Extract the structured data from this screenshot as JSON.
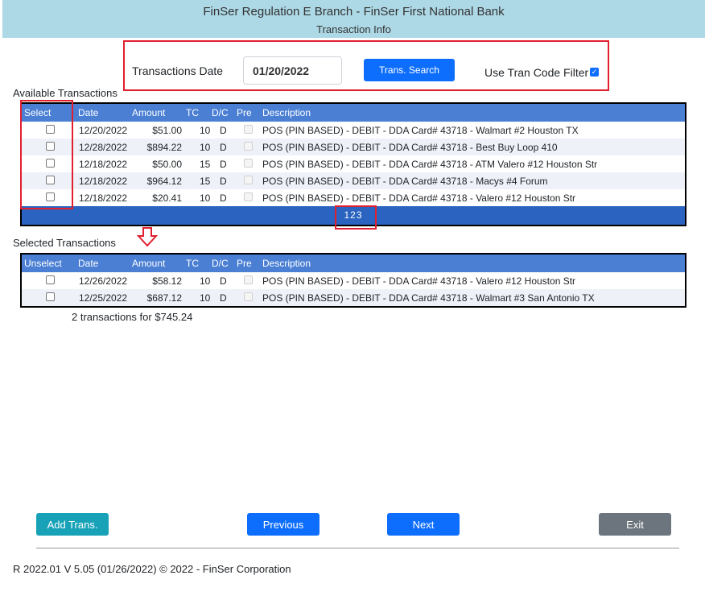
{
  "header": {
    "title": "FinSer Regulation E Branch - FinSer First National Bank",
    "subtitle": "Transaction Info"
  },
  "search": {
    "date_label": "Transactions Date",
    "date_value": "01/20/2022",
    "search_button": "Trans. Search",
    "filter_label": "Use Tran Code Filter",
    "filter_checked": true
  },
  "available": {
    "title": "Available Transactions",
    "columns": {
      "select": "Select",
      "date": "Date",
      "amount": "Amount",
      "tc": "TC",
      "dc": "D/C",
      "pre": "Pre",
      "description": "Description"
    },
    "rows": [
      {
        "date": "12/20/2022",
        "amount": "$51.00",
        "tc": "10",
        "dc": "D",
        "description": "POS (PIN BASED) - DEBIT - DDA Card# 43718 - Walmart #2 Houston TX"
      },
      {
        "date": "12/28/2022",
        "amount": "$894.22",
        "tc": "10",
        "dc": "D",
        "description": "POS (PIN BASED) - DEBIT - DDA Card# 43718 - Best Buy Loop 410"
      },
      {
        "date": "12/18/2022",
        "amount": "$50.00",
        "tc": "15",
        "dc": "D",
        "description": "POS (PIN BASED) - DEBIT - DDA Card# 43718 - ATM Valero #12 Houston Str"
      },
      {
        "date": "12/18/2022",
        "amount": "$964.12",
        "tc": "15",
        "dc": "D",
        "description": "POS (PIN BASED) - DEBIT - DDA Card# 43718 - Macys #4 Forum"
      },
      {
        "date": "12/18/2022",
        "amount": "$20.41",
        "tc": "10",
        "dc": "D",
        "description": "POS (PIN BASED) - DEBIT - DDA Card# 43718 - Valero #12 Houston Str"
      }
    ],
    "pager": "123"
  },
  "selected": {
    "title": "Selected Transactions",
    "columns": {
      "select": "Unselect",
      "date": "Date",
      "amount": "Amount",
      "tc": "TC",
      "dc": "D/C",
      "pre": "Pre",
      "description": "Description"
    },
    "rows": [
      {
        "date": "12/26/2022",
        "amount": "$58.12",
        "tc": "10",
        "dc": "D",
        "description": "POS (PIN BASED) - DEBIT - DDA Card# 43718 - Valero #12 Houston Str"
      },
      {
        "date": "12/25/2022",
        "amount": "$687.12",
        "tc": "10",
        "dc": "D",
        "description": "POS (PIN BASED) - DEBIT - DDA Card# 43718 - Walmart #3 San Antonio TX"
      }
    ],
    "summary": "2 transactions for $745.24"
  },
  "buttons": {
    "add": "Add Trans.",
    "previous": "Previous",
    "next": "Next",
    "exit": "Exit"
  },
  "footer": {
    "version": "R 2022.01 V 5.05 (01/26/2022) © 2022 - FinSer Corporation"
  },
  "colors": {
    "header_bg": "#add8e6",
    "table_header": "#4a7fd4",
    "pager_bg": "#2a64c0",
    "highlight": "#e0202f",
    "primary": "#0d6efd",
    "teal": "#17a2b8",
    "gray": "#6c757d"
  }
}
